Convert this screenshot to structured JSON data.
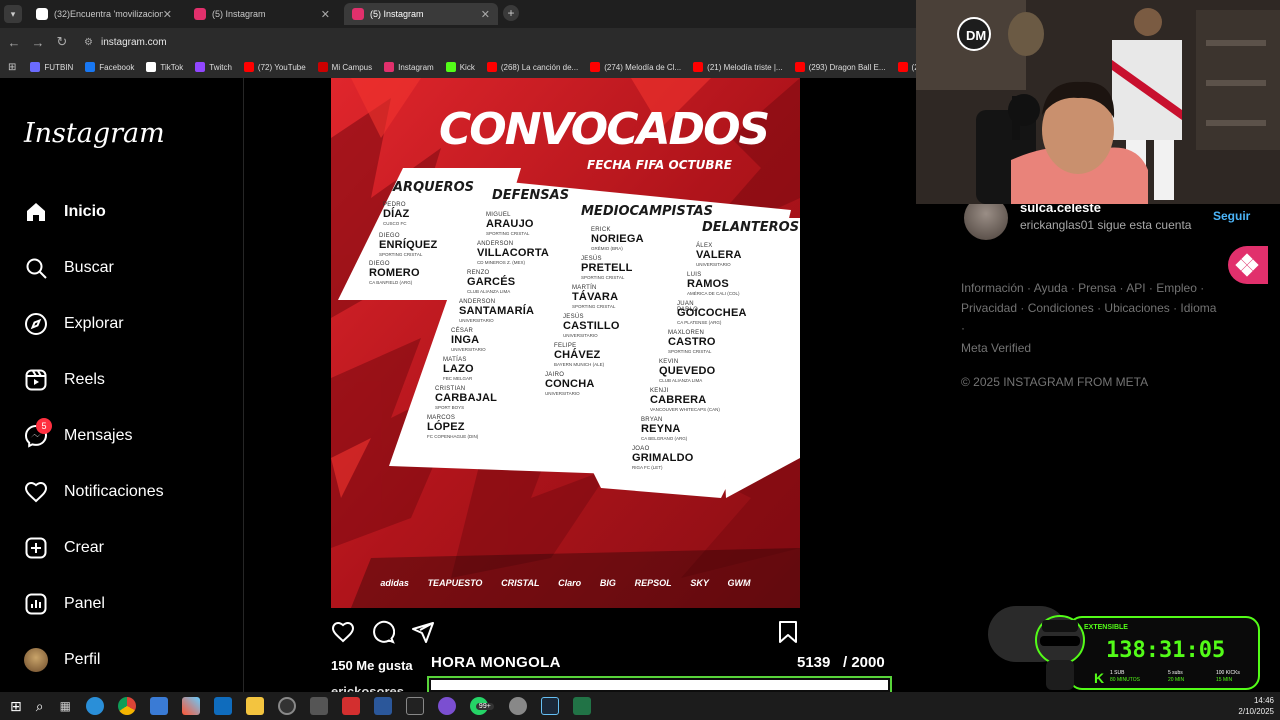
{
  "browser": {
    "tabs": [
      {
        "title": "(32)Encuentra 'movilizacion cer",
        "active": false,
        "favicon_color": "#ffffff"
      },
      {
        "title": "(5) Instagram",
        "active": false,
        "favicon_color": "#e1306c"
      },
      {
        "title": "(5) Instagram",
        "active": true,
        "favicon_color": "#e1306c"
      }
    ],
    "url": "instagram.com",
    "bookmarks": [
      {
        "label": "FUTBIN",
        "color": "#6b6bff"
      },
      {
        "label": "Facebook",
        "color": "#1877f2"
      },
      {
        "label": "TikTok",
        "color": "#ffffff"
      },
      {
        "label": "Twitch",
        "color": "#9146ff"
      },
      {
        "label": "(72) YouTube",
        "color": "#ff0000"
      },
      {
        "label": "Mi Campus",
        "color": "#c00"
      },
      {
        "label": "Instagram",
        "color": "#e1306c"
      },
      {
        "label": "Kick",
        "color": "#53fc18"
      },
      {
        "label": "(268) La canción de...",
        "color": "#ff0000"
      },
      {
        "label": "(274) Melodía de Cl...",
        "color": "#ff0000"
      },
      {
        "label": "(21) Melodía triste |...",
        "color": "#ff0000"
      },
      {
        "label": "(293) Dragon Ball E...",
        "color": "#ff0000"
      },
      {
        "label": "(2",
        "color": "#ff0000"
      }
    ]
  },
  "sidebar": {
    "logo": "Instagram",
    "items": [
      {
        "label": "Inicio",
        "icon": "home-icon",
        "bold": true
      },
      {
        "label": "Buscar",
        "icon": "search-icon"
      },
      {
        "label": "Explorar",
        "icon": "compass-icon"
      },
      {
        "label": "Reels",
        "icon": "reels-icon"
      },
      {
        "label": "Mensajes",
        "icon": "messenger-icon",
        "badge": "5"
      },
      {
        "label": "Notificaciones",
        "icon": "heart-icon"
      },
      {
        "label": "Crear",
        "icon": "plus-square-icon"
      },
      {
        "label": "Panel",
        "icon": "dashboard-icon"
      },
      {
        "label": "Perfil",
        "icon": "avatar"
      }
    ]
  },
  "post_image": {
    "title_a": "CONVOCA",
    "title_b": "DOS",
    "subtitle": "FECHA FIFA OCTUBRE",
    "groups": [
      {
        "heading": "ARQUEROS",
        "players": [
          {
            "first": "PEDRO",
            "last": "DÍAZ",
            "club": "CUSCO FC"
          },
          {
            "first": "DIEGO",
            "last": "ENRÍQUEZ",
            "club": "SPORTING CRISTAL"
          },
          {
            "first": "DIEGO",
            "last": "ROMERO",
            "club": "CA BANFIELD (ARG)"
          }
        ]
      },
      {
        "heading": "DEFENSAS",
        "players": [
          {
            "first": "MIGUEL",
            "last": "ARAUJO",
            "club": "SPORTING CRISTAL"
          },
          {
            "first": "ANDERSON",
            "last": "VILLACORTA",
            "club": "CD MINEROS Z. (MEX)"
          },
          {
            "first": "RENZO",
            "last": "GARCÉS",
            "club": "CLUB ALIANZA LIMA"
          },
          {
            "first": "ANDERSON",
            "last": "SANTAMARÍA",
            "club": "UNIVERSITARIO"
          },
          {
            "first": "CÉSAR",
            "last": "INGA",
            "club": "UNIVERSITARIO"
          },
          {
            "first": "MATÍAS",
            "last": "LAZO",
            "club": "FBC MELGAR"
          },
          {
            "first": "CRISTIAN",
            "last": "CARBAJAL",
            "club": "SPORT BOYS"
          },
          {
            "first": "MARCOS",
            "last": "LÓPEZ",
            "club": "FC COPENHAGUE (DIN)"
          }
        ]
      },
      {
        "heading": "MEDIOCAMPISTAS",
        "players": [
          {
            "first": "ERICK",
            "last": "NORIEGA",
            "club": "GRÊMIO (BRA)"
          },
          {
            "first": "JESÚS",
            "last": "PRETELL",
            "club": "SPORTING CRISTAL"
          },
          {
            "first": "MARTÍN",
            "last": "TÁVARA",
            "club": "SPORTING CRISTAL"
          },
          {
            "first": "JESÚS",
            "last": "CASTILLO",
            "club": "UNIVERSITARIO"
          },
          {
            "first": "FELIPE",
            "last": "CHÁVEZ",
            "club": "BAYERN MUNICH (ALE)"
          },
          {
            "first": "JAIRO",
            "last": "CONCHA",
            "club": "UNIVERSITARIO"
          }
        ]
      },
      {
        "heading": "DELANTEROS",
        "players": [
          {
            "first": "ÁLEX",
            "last": "VALERA",
            "club": "UNIVERSITARIO"
          },
          {
            "first": "LUIS",
            "last": "RAMOS",
            "club": "AMÉRICA DE CALI (COL)"
          },
          {
            "first": "JUAN PABLO",
            "last": "GOICOCHEA",
            "club": "CA PLATENSE (ARG)"
          },
          {
            "first": "MAXLOREN",
            "last": "CASTRO",
            "club": "SPORTING CRISTAL"
          },
          {
            "first": "KEVIN",
            "last": "QUEVEDO",
            "club": "CLUB ALIANZA LIMA"
          },
          {
            "first": "KENJI",
            "last": "CABRERA",
            "club": "VANCOUVER WHITECAPS (CAN)"
          },
          {
            "first": "BRYAN",
            "last": "REYNA",
            "club": "CA BELGRANO (ARG)"
          },
          {
            "first": "JOAO",
            "last": "GRIMALDO",
            "club": "RIGA FC (LET)"
          }
        ]
      }
    ],
    "sponsors": [
      "adidas",
      "TEAPUESTO",
      "CRISTAL",
      "Claro",
      "BIG",
      "REPSOL",
      "SKY",
      "GWM"
    ]
  },
  "post_actions": {
    "like": "heart-icon",
    "comment": "comment-icon",
    "share": "share-icon",
    "save": "bookmark-icon"
  },
  "likes": "150 Me gusta",
  "author": "erickosores",
  "suggestion": {
    "username": "sulca.celeste",
    "subtitle": "erickanglas01 sigue esta cuenta",
    "follow": "Seguir"
  },
  "footer": {
    "line1": "Información · Ayuda · Prensa · API · Empleo ·",
    "line2": "Privacidad · Condiciones · Ubicaciones · Idioma ·",
    "line3": "Meta Verified",
    "copyright": "© 2025 INSTAGRAM FROM META"
  },
  "stream_overlay": {
    "label": "HORA MONGOLA",
    "count": "5139",
    "goal": "/ 2000",
    "timer": "138:31:05",
    "extensible": "EXTENSIBLE",
    "sub_text": "1 SUB",
    "sub_value": "80 MINUTOS",
    "kicks_a": "5 subs",
    "kicks_a_value": "20 MIN",
    "kicks_b": "100 KICKs",
    "kicks_b_value": "15 MIN"
  },
  "taskbar": {
    "time": "14:46",
    "date": "2/10/2025",
    "notification": "99+"
  }
}
